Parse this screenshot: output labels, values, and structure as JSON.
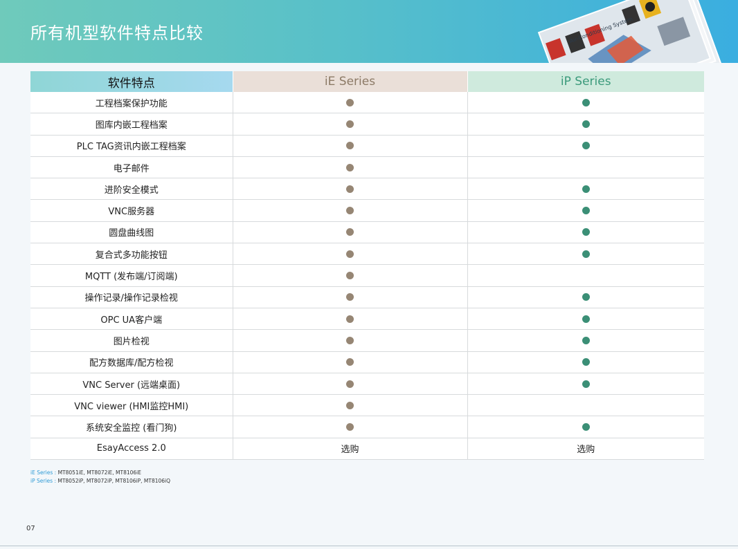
{
  "header": {
    "title": "所有机型软件特点比较",
    "brochure_text": "Air-Conditioning System"
  },
  "table": {
    "headers": [
      "软件特点",
      "iE Series",
      "iP Series"
    ],
    "rows": [
      {
        "feature": "工程档案保护功能",
        "ie": "dot",
        "ip": "dot"
      },
      {
        "feature": "图库内嵌工程档案",
        "ie": "dot",
        "ip": "dot"
      },
      {
        "feature": "PLC TAG资讯内嵌工程档案",
        "ie": "dot",
        "ip": "dot"
      },
      {
        "feature": "电子邮件",
        "ie": "dot",
        "ip": ""
      },
      {
        "feature": "进阶安全模式",
        "ie": "dot",
        "ip": "dot"
      },
      {
        "feature": "VNC服务器",
        "ie": "dot",
        "ip": "dot"
      },
      {
        "feature": "圆盘曲线图",
        "ie": "dot",
        "ip": "dot"
      },
      {
        "feature": "复合式多功能按钮",
        "ie": "dot",
        "ip": "dot"
      },
      {
        "feature": "MQTT (发布端/订阅端)",
        "ie": "dot",
        "ip": ""
      },
      {
        "feature": "操作记录/操作记录检视",
        "ie": "dot",
        "ip": "dot"
      },
      {
        "feature": "OPC UA客户端",
        "ie": "dot",
        "ip": "dot"
      },
      {
        "feature": "图片检视",
        "ie": "dot",
        "ip": "dot"
      },
      {
        "feature": "配方数据库/配方检视",
        "ie": "dot",
        "ip": "dot"
      },
      {
        "feature": "VNC Server (远端桌面)",
        "ie": "dot",
        "ip": "dot"
      },
      {
        "feature": "VNC viewer (HMI监控HMI)",
        "ie": "dot",
        "ip": ""
      },
      {
        "feature": "系统安全监控 (看门狗)",
        "ie": "dot",
        "ip": "dot"
      },
      {
        "feature": "EsayAccess 2.0",
        "ie": "选购",
        "ip": "选购"
      }
    ]
  },
  "notes": {
    "ie_label": "iE Series :",
    "ie_models": "MT8051iE, MT8072iE, MT8106iE",
    "ip_label": "iP Series :",
    "ip_models": "MT8052iP, MT8072iP, MT8106iP, MT8106iQ"
  },
  "page_number": "07",
  "colors": {
    "ie_dot": "#968674",
    "ip_dot": "#3b8f76",
    "header_start": "#6fcabb",
    "header_end": "#3aaee0"
  }
}
